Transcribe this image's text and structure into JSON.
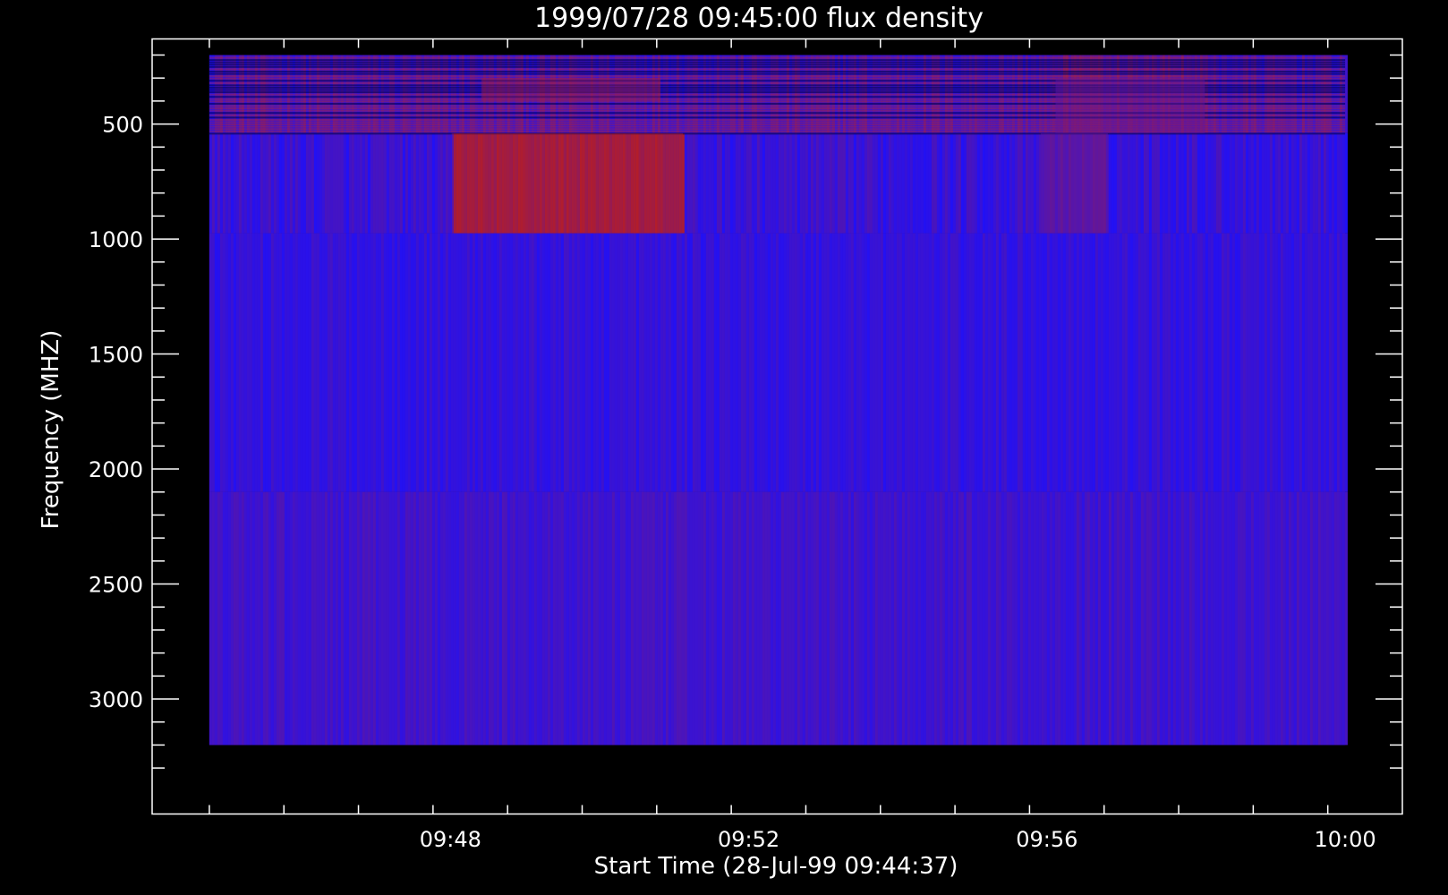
{
  "chart_data": {
    "type": "heatmap",
    "title": "1999/07/28 09:45:00 flux density",
    "xlabel": "Start Time (28-Jul-99 09:44:37)",
    "ylabel": "Frequency (MHZ)",
    "x_tick_labels": [
      "09:48",
      "09:52",
      "09:56",
      "10:00"
    ],
    "x_tick_values_min": [
      3.383,
      7.383,
      11.383,
      15.383
    ],
    "x_minor_step_min": 1,
    "xlim_min": [
      -0.617,
      16.15
    ],
    "data_xlim_min": [
      0.15,
      15.383
    ],
    "y_tick_labels": [
      "500",
      "1000",
      "1500",
      "2000",
      "2500",
      "3000"
    ],
    "y_tick_values": [
      500,
      1000,
      1500,
      2000,
      2500,
      3000
    ],
    "y_minor_step": 100,
    "ylim": [
      3500,
      130
    ],
    "data_ylim": [
      200,
      3200
    ],
    "colors": {
      "background": "#000000",
      "low": "#1a10ff",
      "high": "#d02000",
      "axis": "#ffffff"
    },
    "bands": [
      {
        "f_min": 200,
        "f_max": 540,
        "base_level": 0.22,
        "noise": "high"
      },
      {
        "f_min": 540,
        "f_max": 975,
        "base_level": 0.16,
        "noise": "medium"
      },
      {
        "f_min": 975,
        "f_max": 2100,
        "base_level": 0.14,
        "noise": "low"
      },
      {
        "f_min": 2100,
        "f_max": 3200,
        "base_level": 0.2,
        "noise": "low"
      }
    ],
    "bursts": [
      {
        "t_start_min": 3.4,
        "t_end_min": 6.5,
        "f_min": 540,
        "f_max": 975,
        "level": 0.75
      },
      {
        "t_start_min": 3.8,
        "t_end_min": 6.2,
        "f_min": 300,
        "f_max": 400,
        "level": 0.7
      },
      {
        "t_start_min": 11.5,
        "t_end_min": 13.5,
        "f_min": 300,
        "f_max": 540,
        "level": 0.4
      },
      {
        "t_start_min": 11.3,
        "t_end_min": 12.2,
        "f_min": 540,
        "f_max": 975,
        "level": 0.35
      }
    ]
  }
}
